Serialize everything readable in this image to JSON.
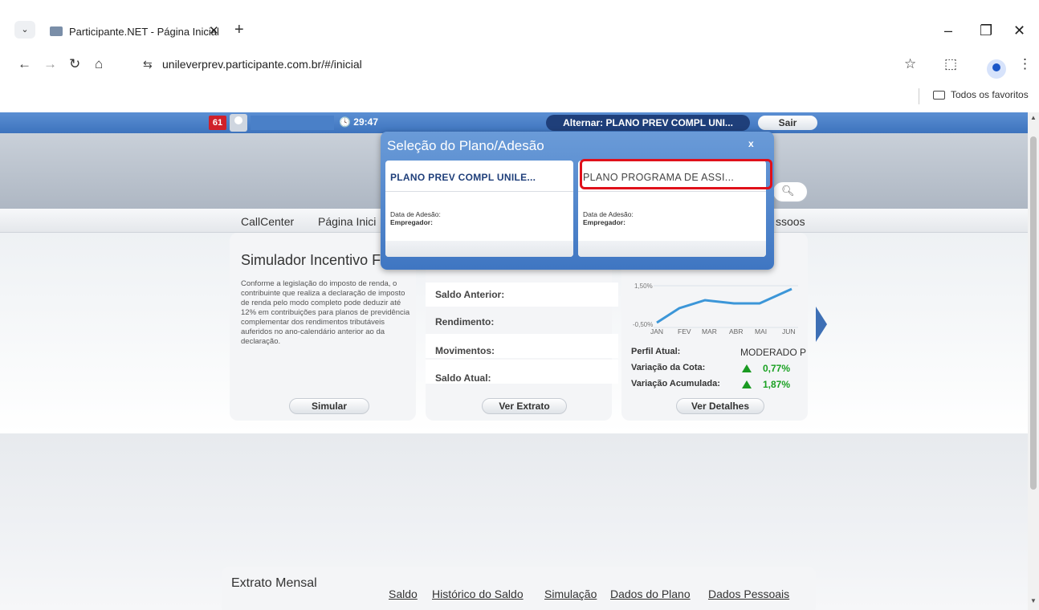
{
  "browser": {
    "tab_menu_icon": "chevron-down-icon",
    "tab_title": "Participante.NET - Página Inicial",
    "tab_close": "✕",
    "new_tab": "+",
    "url": "unileverprev.participante.com.br/#/inicial",
    "bookmarks_label": "Todos os favoritos"
  },
  "page": {
    "notification_count": "61",
    "timer": "29:47",
    "alternar_label": "Alternar: PLANO PREV COMPL UNI...",
    "sair_label": "Sair",
    "menu": [
      "CallCenter",
      "Página Inici",
      "ssoos"
    ],
    "cards": {
      "simulador": {
        "title": "Simulador Incentivo F",
        "text": "Conforme a legislação do imposto de renda, o contribuinte que realiza a declaração de imposto de renda pelo modo completo pode deduzir até 12% em contribuições para planos de previdência complementar dos rendimentos tributáveis auferidos no ano-calendário anterior ao da declaração.",
        "button": "Simular"
      },
      "extrato": {
        "rows": [
          "Saldo Anterior:",
          "Rendimento:",
          "Movimentos:",
          "Saldo Atual:"
        ],
        "button": "Ver Extrato"
      },
      "perfil": {
        "chart_labels": [
          "1,50%",
          "-0,50%"
        ],
        "months": [
          "JAN",
          "FEV",
          "MAR",
          "ABR",
          "MAI",
          "JUN"
        ],
        "perfil_label": "Perfil Atual:",
        "perfil_value": "MODERADO P",
        "variacao_cota_label": "Variação da Cota:",
        "variacao_cota_value": "0,77%",
        "variacao_acum_label": "Variação Acumulada:",
        "variacao_acum_value": "1,87%",
        "button": "Ver Detalhes"
      }
    },
    "extrato_mensal": {
      "title": "Extrato Mensal",
      "links": [
        "Saldo",
        "Histórico do Saldo",
        "Simulação",
        "Dados do Plano",
        "Dados Pessoais"
      ]
    }
  },
  "modal": {
    "title": "Seleção do Plano/Adesão",
    "close": "x",
    "plans": [
      {
        "name": "PLANO PREV COMPL UNILE...",
        "adesao_label": "Data de Adesão:",
        "empregador_label": "Empregador:"
      },
      {
        "name": "PLANO PROGRAMA DE ASSI...",
        "adesao_label": "Data de Adesão:",
        "empregador_label": "Empregador:"
      }
    ]
  },
  "colors": {
    "accent_blue": "#3d73bd",
    "highlight_red": "#e0101a",
    "positive_green": "#1aa122"
  }
}
